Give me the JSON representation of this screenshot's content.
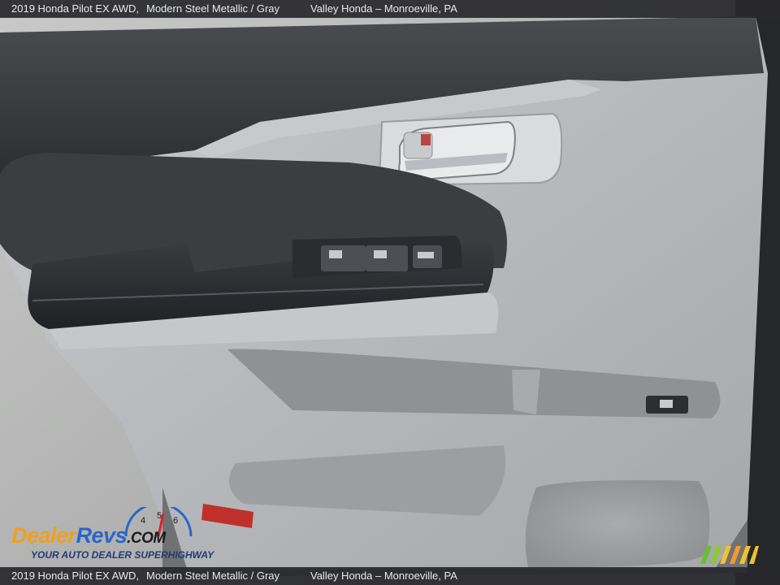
{
  "caption": {
    "vehicle": "2019 Honda Pilot EX AWD,",
    "color": "Modern Steel Metallic / Gray",
    "dealer": "Valley Honda – Monroeville, PA"
  },
  "logo": {
    "part1": "Dealer",
    "part2": "Revs",
    "part3": ".COM",
    "tagline": "YOUR AUTO DEALER SUPERHIGHWAY",
    "gauge_digits": [
      "4",
      "5",
      "6"
    ]
  },
  "colors": {
    "door_panel": "#b8babd",
    "armrest": "#2e3034",
    "upper_trim": "#3a3c40",
    "handle_chrome": "#d4d6d9",
    "reflector": "#c0302a"
  }
}
